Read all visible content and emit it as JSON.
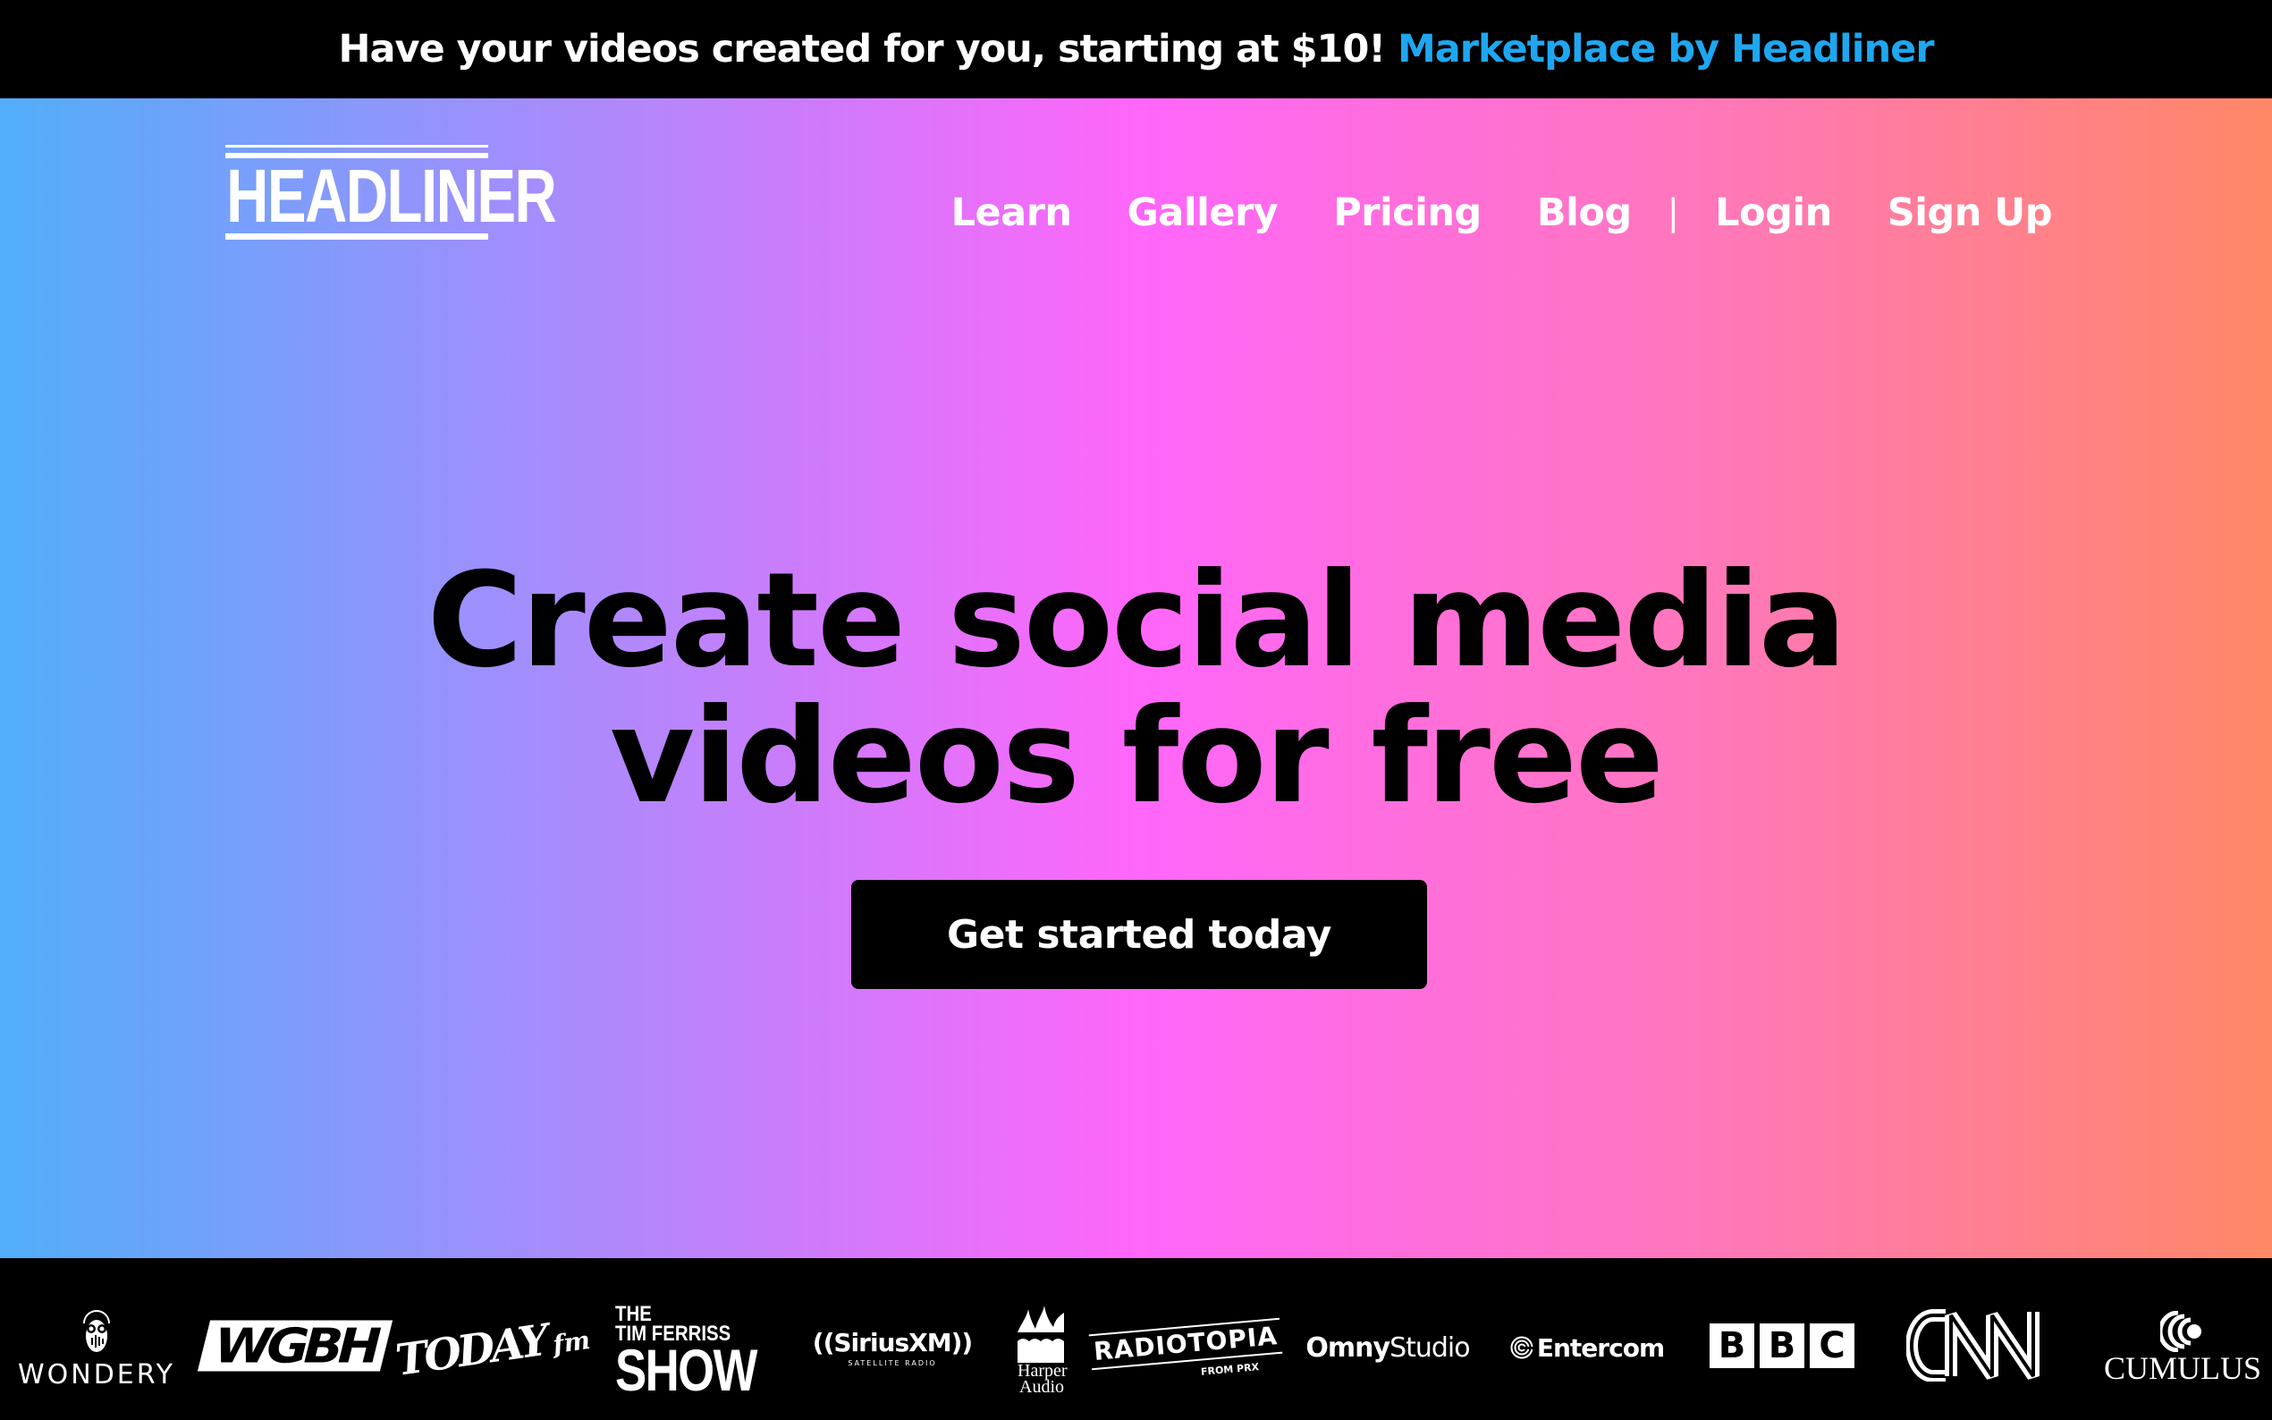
{
  "promo": {
    "text": "Have your videos created for you, starting at $10!",
    "link_label": "Marketplace by Headliner",
    "link_color": "#1ea7f0"
  },
  "brand": {
    "logo_text": "HEADLINER"
  },
  "nav": {
    "items": [
      {
        "label": "Learn"
      },
      {
        "label": "Gallery"
      },
      {
        "label": "Pricing"
      },
      {
        "label": "Blog"
      }
    ],
    "separator": "|",
    "login": "Login",
    "signup": "Sign Up"
  },
  "hero": {
    "headline_line1": "Create social media",
    "headline_line2": "videos for free",
    "cta_label": "Get started today",
    "gradient": [
      "#52aefa",
      "#a98bfc",
      "#ff66fa",
      "#ff77bb",
      "#ff8866"
    ]
  },
  "partners": {
    "wondery": "WONDERY",
    "wgbh": "WGBH",
    "todayfm_main": "TODAY",
    "todayfm_suffix": "fm",
    "ferriss_line1": "THE",
    "ferriss_line2": "TIM FERRISS",
    "ferriss_line3": "SHOW",
    "sirius_main": "((SiriusXM))",
    "sirius_sub": "SATELLITE RADIO",
    "harper_line1": "Harper",
    "harper_line2": "Audio",
    "radiotopia": "RADIOTOPIA",
    "radiotopia_from": "FROM PRX",
    "omny_bold": "Omny",
    "omny_light": "Studio",
    "entercom": "Entercom",
    "bbc": [
      "B",
      "B",
      "C"
    ],
    "cnn": "CNN",
    "cumulus": "CUMULUS"
  }
}
